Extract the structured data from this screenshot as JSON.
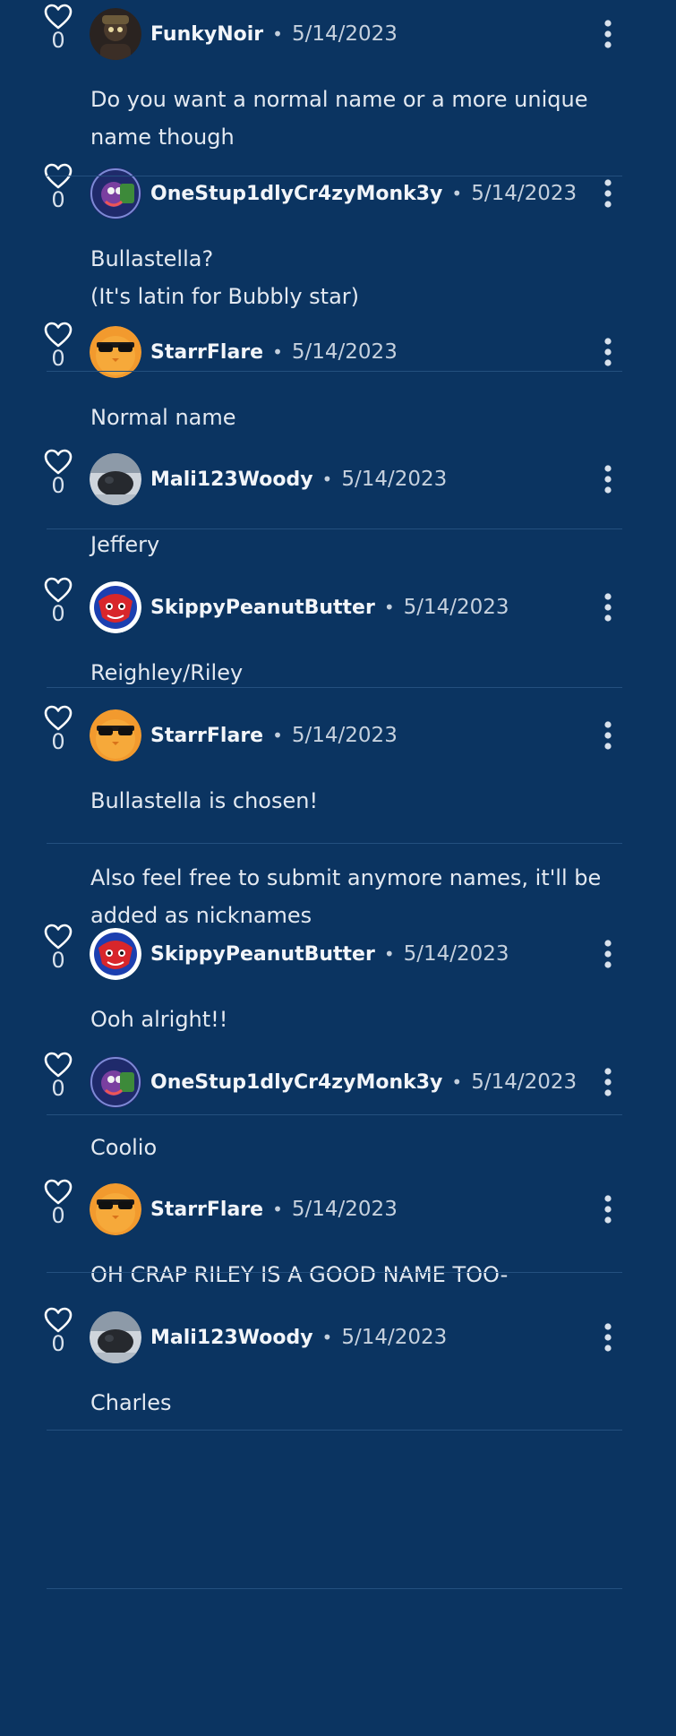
{
  "comments": [
    {
      "user": "FunkyNoir",
      "date": "5/14/2023",
      "likes": "0",
      "avatar": "dark-character-avatar",
      "lines": [
        "Do you want a normal name or a more unique",
        "name though"
      ]
    },
    {
      "user": "OneStup1dlyCr4zyMonk3y",
      "date": "5/14/2023",
      "likes": "0",
      "avatar": "monkey-avatar",
      "lines": [
        "Bullastella?",
        "(It's latin for Bubbly star)"
      ]
    },
    {
      "user": "StarrFlare",
      "date": "5/14/2023",
      "likes": "0",
      "avatar": "sunglasses-bird-avatar",
      "lines": [
        "Normal name"
      ]
    },
    {
      "user": "Mali123Woody",
      "date": "5/14/2023",
      "likes": "0",
      "avatar": "dark-blob-avatar",
      "lines": [
        "Jeffery"
      ]
    },
    {
      "user": "SkippyPeanutButter",
      "date": "5/14/2023",
      "likes": "0",
      "avatar": "red-blue-avatar",
      "lines": [
        "Reighley/Riley"
      ]
    },
    {
      "user": "StarrFlare",
      "date": "5/14/2023",
      "likes": "0",
      "avatar": "sunglasses-bird-avatar",
      "lines": [
        "Bullastella is chosen!",
        "",
        "Also feel free to submit anymore names, it'll be",
        "added as nicknames"
      ]
    },
    {
      "user": "SkippyPeanutButter",
      "date": "5/14/2023",
      "likes": "0",
      "avatar": "red-blue-avatar",
      "lines": [
        "Ooh alright!!"
      ]
    },
    {
      "user": "OneStup1dlyCr4zyMonk3y",
      "date": "5/14/2023",
      "likes": "0",
      "avatar": "monkey-avatar",
      "lines": [
        "Coolio"
      ]
    },
    {
      "user": "StarrFlare",
      "date": "5/14/2023",
      "likes": "0",
      "avatar": "sunglasses-bird-avatar",
      "lines": [
        "OH CRAP RILEY IS A GOOD NAME TOO-"
      ]
    },
    {
      "user": "Mali123Woody",
      "date": "5/14/2023",
      "likes": "0",
      "avatar": "dark-blob-avatar",
      "lines": [
        "Charles"
      ]
    }
  ],
  "icons": {
    "like": "heart-outline-icon",
    "more": "vertical-dots-icon"
  },
  "colors": {
    "background": "#0b3461",
    "divider": "#24507f",
    "text": "#e3e9f1"
  }
}
